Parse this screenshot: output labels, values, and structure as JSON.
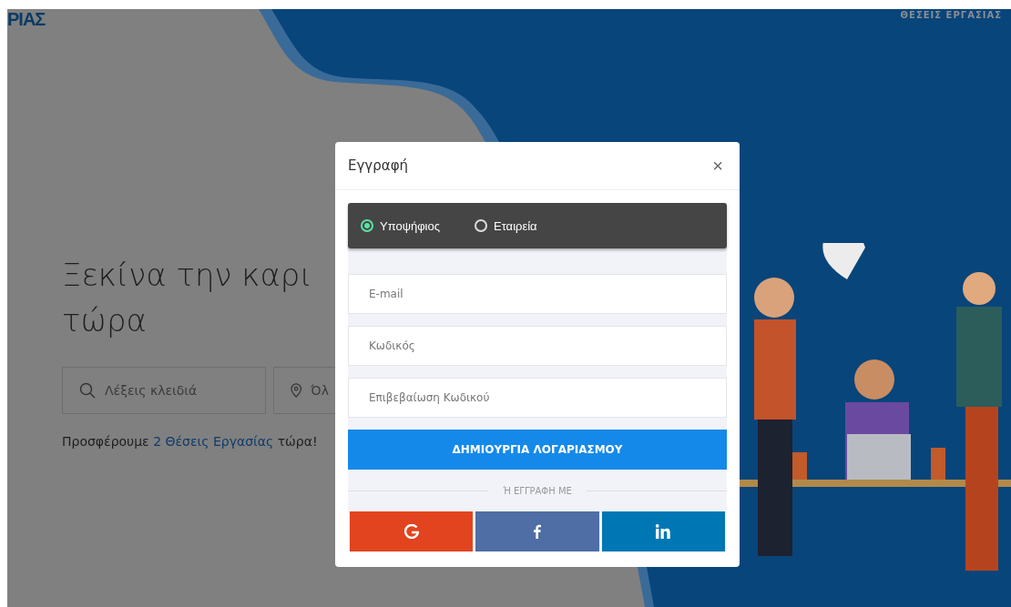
{
  "header": {
    "logo": "ΡΙΑΣ",
    "nav": [
      "ΘΕΣΕΙΣ ΕΡΓΑΣΙΑΣ"
    ]
  },
  "hero": {
    "title_lines": [
      "Ξεκίνα την καρι",
      "τώρα"
    ],
    "keyword_field": {
      "placeholder": "Λέξεις κλειδιά"
    },
    "location_field": {
      "placeholder": "Όλ"
    },
    "offer": {
      "before": "Προσφέρουμε ",
      "link": "2 Θέσεις Εργασίας",
      "after": " τώρα!"
    }
  },
  "modal": {
    "title": "Εγγραφή",
    "close": "×",
    "account_types": [
      {
        "label": "Υποψήφιος",
        "selected": true
      },
      {
        "label": "Εταιρεία",
        "selected": false
      }
    ],
    "fields": [
      {
        "placeholder": "E-mail"
      },
      {
        "placeholder": "Κωδικός"
      },
      {
        "placeholder": "Επιβεβαίωση Κωδικού"
      }
    ],
    "submit": "ΔΗΜΙΟΥΡΓΙΑ ΛΟΓΑΡΙΑΣΜΟΥ",
    "divider": "Ή ΕΓΓΡΑΦΗ ΜΕ",
    "social": [
      {
        "kind": "google",
        "color": "#e1441e"
      },
      {
        "kind": "facebook",
        "color": "#4e6ea5"
      },
      {
        "kind": "linkedin",
        "color": "#0077b5"
      }
    ]
  }
}
